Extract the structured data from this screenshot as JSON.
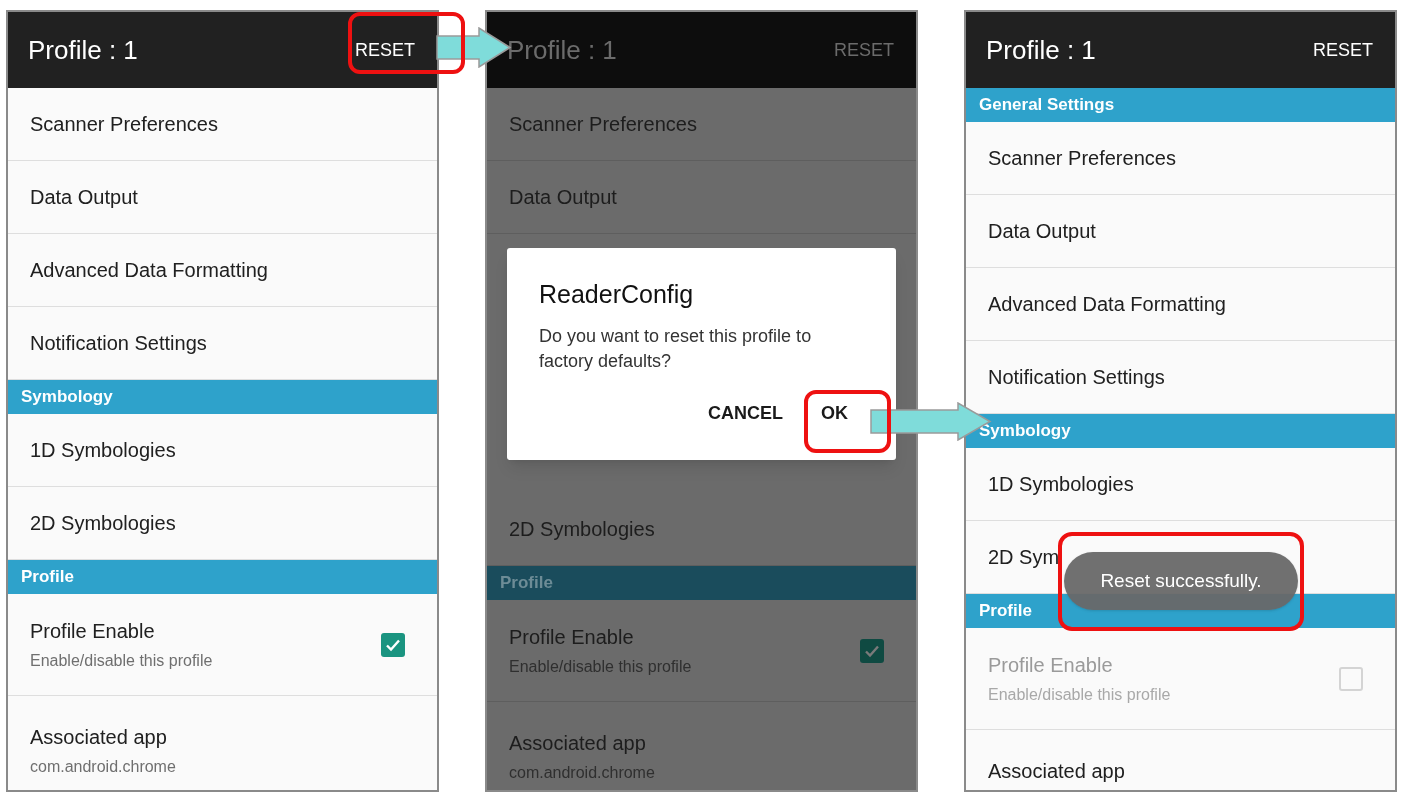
{
  "phones": [
    {
      "title": "Profile : 1",
      "action": "RESET",
      "dimmed": false,
      "items": [
        {
          "kind": "row",
          "label": "Scanner Preferences"
        },
        {
          "kind": "row",
          "label": "Data Output"
        },
        {
          "kind": "row",
          "label": "Advanced Data Formatting"
        },
        {
          "kind": "row",
          "label": "Notification Settings"
        },
        {
          "kind": "section",
          "label": "Symbology"
        },
        {
          "kind": "row",
          "label": "1D Symbologies"
        },
        {
          "kind": "row",
          "label": "2D Symbologies"
        },
        {
          "kind": "section",
          "label": "Profile"
        },
        {
          "kind": "toggle",
          "label": "Profile Enable",
          "summary": "Enable/disable this profile",
          "checked": true,
          "disabled": false
        },
        {
          "kind": "detail",
          "label": "Associated app",
          "summary": "com.android.chrome"
        }
      ]
    },
    {
      "title": "Profile : 1",
      "action": "RESET",
      "dimmed": true,
      "items": [
        {
          "kind": "row",
          "label": "Scanner Preferences"
        },
        {
          "kind": "row",
          "label": "Data Output"
        },
        {
          "kind": "covered"
        },
        {
          "kind": "row",
          "label": "2D Symbologies"
        },
        {
          "kind": "section",
          "label": "Profile"
        },
        {
          "kind": "toggle",
          "label": "Profile Enable",
          "summary": "Enable/disable this profile",
          "checked": true,
          "disabled": false
        },
        {
          "kind": "detail",
          "label": "Associated app",
          "summary": "com.android.chrome"
        }
      ],
      "dialog": {
        "title": "ReaderConfig",
        "message": "Do you want to reset this profile to factory defaults?",
        "buttons": [
          "CANCEL",
          "OK"
        ]
      }
    },
    {
      "title": "Profile : 1",
      "action": "RESET",
      "dimmed": false,
      "items": [
        {
          "kind": "section",
          "label": "General Settings"
        },
        {
          "kind": "row",
          "label": "Scanner Preferences"
        },
        {
          "kind": "row",
          "label": "Data Output"
        },
        {
          "kind": "row",
          "label": "Advanced Data Formatting"
        },
        {
          "kind": "row",
          "label": "Notification Settings"
        },
        {
          "kind": "section",
          "label": "Symbology"
        },
        {
          "kind": "row",
          "label": "1D Symbologies"
        },
        {
          "kind": "row",
          "label": "2D Sym"
        },
        {
          "kind": "section",
          "label": "Profile"
        },
        {
          "kind": "toggle",
          "label": "Profile Enable",
          "summary": "Enable/disable this profile",
          "checked": false,
          "disabled": true
        },
        {
          "kind": "detail",
          "label": "Associated app"
        }
      ],
      "toast": "Reset successfully."
    }
  ]
}
